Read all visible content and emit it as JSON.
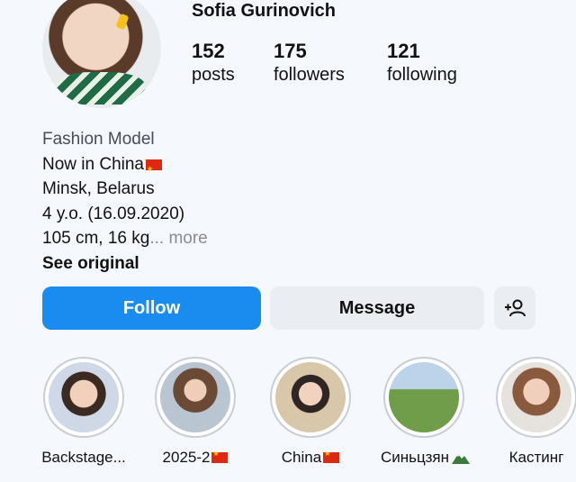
{
  "profile": {
    "username": "Sofia Gurinovich",
    "stats": [
      {
        "value": "152",
        "label": "posts"
      },
      {
        "value": "175",
        "label": "followers"
      },
      {
        "value": "121",
        "label": "following"
      }
    ]
  },
  "bio": {
    "category": "Fashion Model",
    "line1": "Now in China",
    "line2": " Minsk, Belarus",
    "line3": " 4 y.o. (16.09.2020)",
    "line4": " 105 cm, 16 kg",
    "more": "... more",
    "see_original": "See original"
  },
  "actions": {
    "follow": "Follow",
    "message": "Message"
  },
  "highlights": [
    {
      "label": "Backstage..."
    },
    {
      "label": "2025-2"
    },
    {
      "label": "China"
    },
    {
      "label": "Синьцзян"
    },
    {
      "label": "Кастинг"
    }
  ],
  "colors": {
    "follow_bg": "#1a8cf0",
    "secondary_bg": "#eaeef3",
    "flag_red": "#de2910"
  }
}
